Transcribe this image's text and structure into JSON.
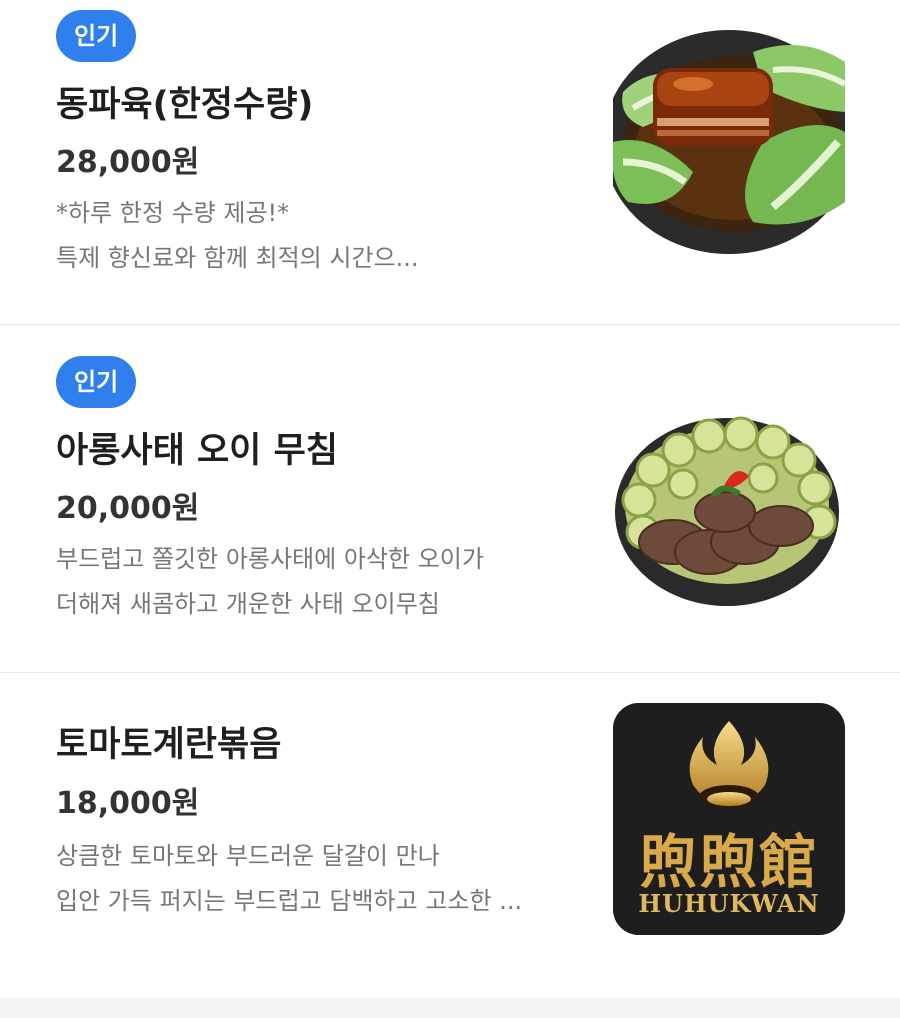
{
  "menu": {
    "items": [
      {
        "badge": "인기",
        "name": "동파육(한정수량)",
        "price": "28,000원",
        "desc_lines": [
          "*하루 한정 수량 제공!*",
          "특제 향신료와 함께 최적의 시간으..."
        ],
        "image_icon": "dongpo-pork-photo"
      },
      {
        "badge": "인기",
        "name": "아롱사태 오이 무침",
        "price": "20,000원",
        "desc_lines": [
          "부드럽고 쫄깃한 아롱사태에 아삭한 오이가",
          "더해져 새콤하고 개운한 사태 오이무침"
        ],
        "image_icon": "beef-shank-cucumber-photo"
      },
      {
        "name": "토마토계란볶음",
        "price": "18,000원",
        "desc_lines": [
          "상큼한 토마토와 부드러운 달걀이 만나",
          "입안 가득 퍼지는 부드럽고 담백하고 고소한 ..."
        ],
        "image_icon": "restaurant-logo",
        "logo_chinese": "煦煦館",
        "logo_english": "HUHUKWAN"
      }
    ]
  },
  "colors": {
    "badge": "#2f80ed",
    "name": "#1f1f1f",
    "description": "#777777",
    "divider": "#ececec"
  }
}
